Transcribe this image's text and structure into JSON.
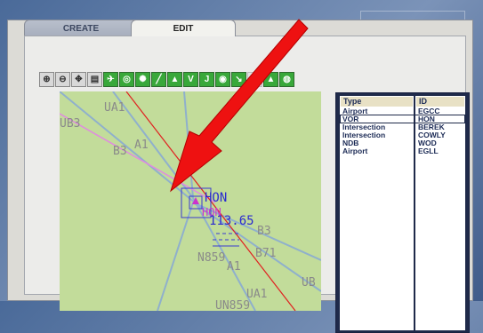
{
  "tabs": [
    {
      "label": "CREATE",
      "active": false
    },
    {
      "label": "EDIT",
      "active": true
    }
  ],
  "toolbar": {
    "buttons": [
      {
        "name": "zoom-in-icon",
        "glyph": "⊕",
        "style": "grey"
      },
      {
        "name": "zoom-out-icon",
        "glyph": "⊖",
        "style": "grey"
      },
      {
        "name": "center-icon",
        "glyph": "✥",
        "style": "grey"
      },
      {
        "name": "print-icon",
        "glyph": "▤",
        "style": "grey"
      },
      {
        "name": "airport-icon",
        "glyph": "✈",
        "style": "green"
      },
      {
        "name": "vor-icon",
        "glyph": "◎",
        "style": "green"
      },
      {
        "name": "ndb-icon",
        "glyph": "✺",
        "style": "green"
      },
      {
        "name": "route-icon",
        "glyph": "╱",
        "style": "green"
      },
      {
        "name": "intersection-icon",
        "glyph": "▲",
        "style": "green"
      },
      {
        "name": "v-icon",
        "glyph": "V",
        "style": "green"
      },
      {
        "name": "j-icon",
        "glyph": "J",
        "style": "green"
      },
      {
        "name": "waypoint-icon",
        "glyph": "◉",
        "style": "green"
      },
      {
        "name": "link-icon",
        "glyph": "↘",
        "style": "green"
      },
      {
        "name": "w-icon",
        "glyph": "W",
        "style": "disabled"
      },
      {
        "name": "terrain-icon",
        "glyph": "▲",
        "style": "green"
      },
      {
        "name": "globe-icon",
        "glyph": "◍",
        "style": "green"
      }
    ]
  },
  "map": {
    "labels": [
      {
        "name": "airway-label-ua1-top",
        "text": "UA1",
        "color": "#8a8a8a"
      },
      {
        "name": "airway-label-ub3",
        "text": "UB3",
        "color": "#8a8a8a"
      },
      {
        "name": "airway-label-b3-left",
        "text": "B3",
        "color": "#8a8a8a"
      },
      {
        "name": "airway-label-a1-top",
        "text": "A1",
        "color": "#8a8a8a"
      },
      {
        "name": "vor-label-hon",
        "text": "HON",
        "color": "#2a2ad0"
      },
      {
        "name": "vor-label-hon-magenta",
        "text": "HON",
        "color": "#cc33cc"
      },
      {
        "name": "vor-frequency-label",
        "text": "113.65",
        "color": "#2a2ad0"
      },
      {
        "name": "airway-label-b3-right",
        "text": "B3",
        "color": "#8a8a8a"
      },
      {
        "name": "airway-label-n859",
        "text": "N859",
        "color": "#8a8a8a"
      },
      {
        "name": "airway-label-b71",
        "text": "B71",
        "color": "#8a8a8a"
      },
      {
        "name": "airway-label-a1-bottom",
        "text": "A1",
        "color": "#8a8a8a"
      },
      {
        "name": "airway-label-ub",
        "text": "UB",
        "color": "#8a8a8a"
      },
      {
        "name": "airway-label-ua1-bottom",
        "text": "UA1",
        "color": "#8a8a8a"
      },
      {
        "name": "airway-label-un859",
        "text": "UN859",
        "color": "#8a8a8a"
      }
    ]
  },
  "list": {
    "headers": {
      "type": "Type",
      "id": "ID"
    },
    "rows": [
      {
        "type": "Airport",
        "id": "EGCC",
        "selected": false
      },
      {
        "type": "VOR",
        "id": "HON",
        "selected": true
      },
      {
        "type": "Intersection",
        "id": "BEREK",
        "selected": false
      },
      {
        "type": "Intersection",
        "id": "COWLY",
        "selected": false
      },
      {
        "type": "NDB",
        "id": "WOD",
        "selected": false
      },
      {
        "type": "Airport",
        "id": "EGLL",
        "selected": false
      }
    ]
  },
  "colors": {
    "accent": "#39a83a",
    "map_bg": "#c2dc9a",
    "arrow": "#ee1111",
    "route": "#e02020"
  }
}
